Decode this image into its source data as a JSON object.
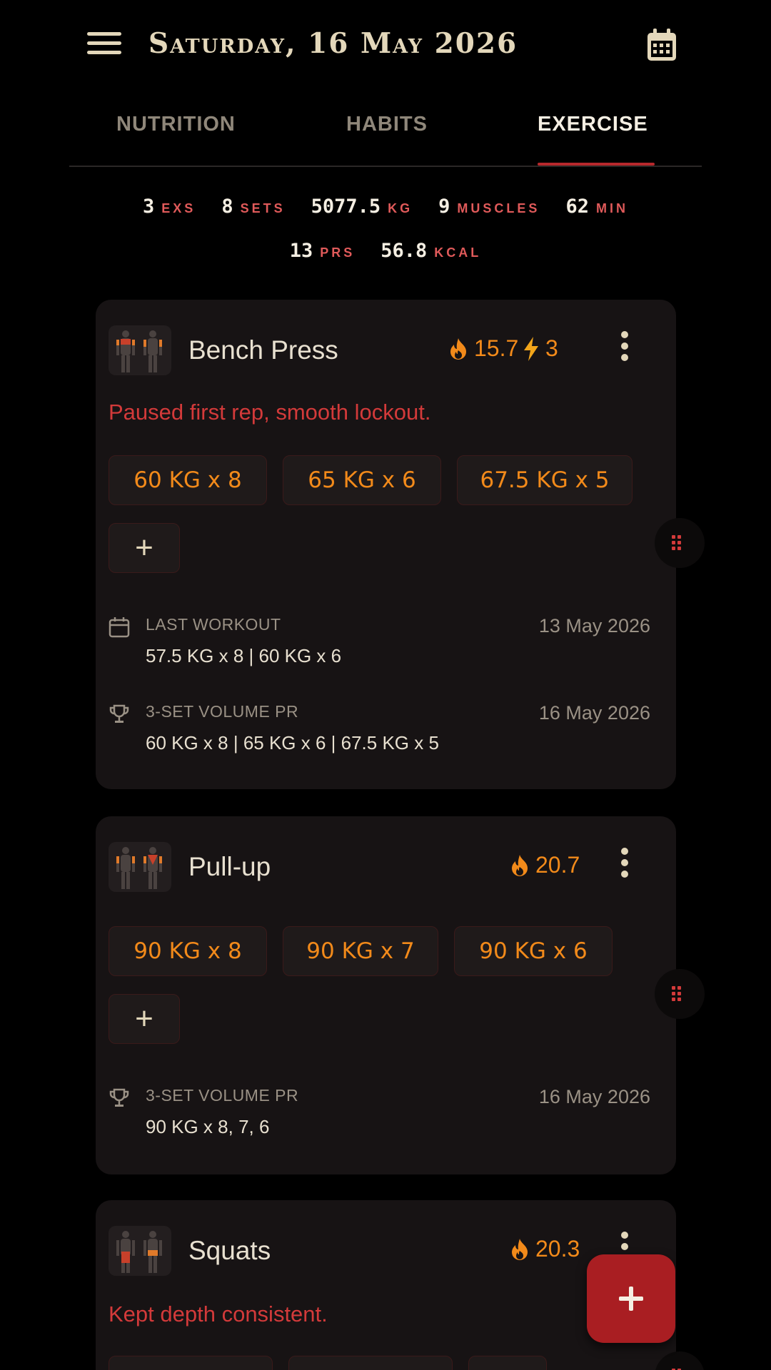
{
  "header": {
    "title": "Saturday, 16 May 2026"
  },
  "tabs": [
    {
      "label": "NUTRITION",
      "active": false
    },
    {
      "label": "HABITS",
      "active": false
    },
    {
      "label": "EXERCISE",
      "active": true
    }
  ],
  "stats": [
    {
      "value": "3",
      "unit": "exs"
    },
    {
      "value": "8",
      "unit": "sets"
    },
    {
      "value": "5077.5",
      "unit": "kg"
    },
    {
      "value": "9",
      "unit": "muscles"
    },
    {
      "value": "62",
      "unit": "min"
    },
    {
      "value": "13",
      "unit": "prs"
    },
    {
      "value": "56.8",
      "unit": "kcal"
    }
  ],
  "exercises": [
    {
      "name": "Bench Press",
      "kcal": "15.7",
      "prs": "3",
      "note": "Paused first rep, smooth lockout.",
      "sets": [
        "60 KG  x  8",
        "65 KG  x  6",
        "67.5 KG  x  5"
      ],
      "last_workout": {
        "label": "LAST WORKOUT",
        "date": "13 May 2026",
        "value": "57.5 KG x 8 | 60 KG x 6"
      },
      "volume_pr": {
        "label": "3-SET VOLUME PR",
        "date": "16 May 2026",
        "value": "60 KG x 8 | 65 KG x 6 | 67.5 KG x 5"
      }
    },
    {
      "name": "Pull-up",
      "kcal": "20.7",
      "sets": [
        "90 KG  x  8",
        "90 KG  x  7",
        "90 KG  x  6"
      ],
      "volume_pr": {
        "label": "3-SET VOLUME PR",
        "date": "16 May 2026",
        "value": "90 KG x 8, 7, 6"
      }
    },
    {
      "name": "Squats",
      "kcal": "20.3",
      "note": "Kept depth consistent."
    }
  ],
  "icons": {
    "menu": "menu-icon",
    "calendar": "calendar-icon",
    "flame": "flame-icon",
    "bolt": "bolt-icon",
    "trophy": "trophy-icon",
    "add": "plus-icon"
  },
  "colors": {
    "accent": "#b7282c",
    "orange": "#f28a1a",
    "note_red": "#d33a3a"
  }
}
